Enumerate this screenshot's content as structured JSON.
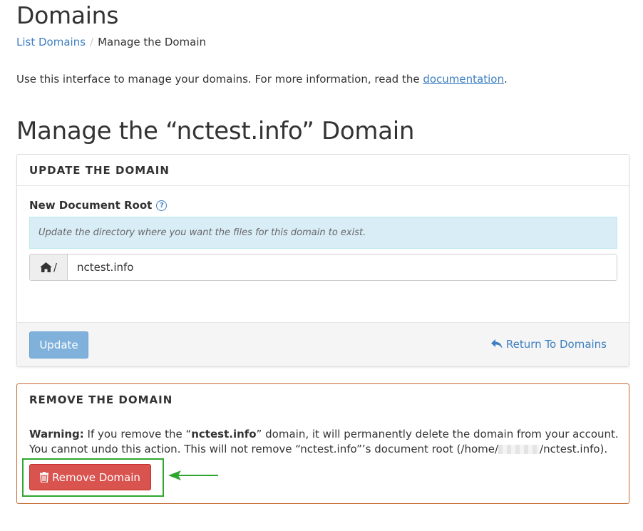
{
  "header": {
    "title": "Domains"
  },
  "breadcrumb": {
    "items": [
      "List Domains",
      "Manage the Domain"
    ],
    "separator": "/"
  },
  "intro": {
    "text": "Use this interface to manage your domains. For more information, read the ",
    "link": "documentation",
    "end": "."
  },
  "manage_title": "Manage the “nctest.info” Domain",
  "update_panel": {
    "title": "UPDATE THE DOMAIN",
    "field_label": "New Document Root",
    "help_icon": "question-circle-icon",
    "help_text": "Update the directory where you want the files for this domain to exist.",
    "addon_icon": "home-icon",
    "addon_text": "/",
    "input_value": "nctest.info",
    "update_button": "Update",
    "return_icon": "reply-arrow-icon",
    "return_link": "Return To Domains"
  },
  "remove_panel": {
    "title": "REMOVE THE DOMAIN",
    "warning_label": "Warning:",
    "warning_part1": " If you remove the “",
    "domain": "nctest.info",
    "warning_part2": "” domain, it will permanently delete the domain from your account.",
    "warning_line2a": "You cannot undo this action. This will not remove “nctest.info”’s document root (/home/",
    "warning_line2b": "/nctest.info).",
    "remove_icon": "trash-icon",
    "remove_button": "Remove Domain"
  },
  "colors": {
    "link": "#3d7fc1",
    "info_bg": "#d9edf7",
    "danger": "#d9534f",
    "panel_warning_border": "#c46a30",
    "annotation_green": "#2fa72f"
  }
}
